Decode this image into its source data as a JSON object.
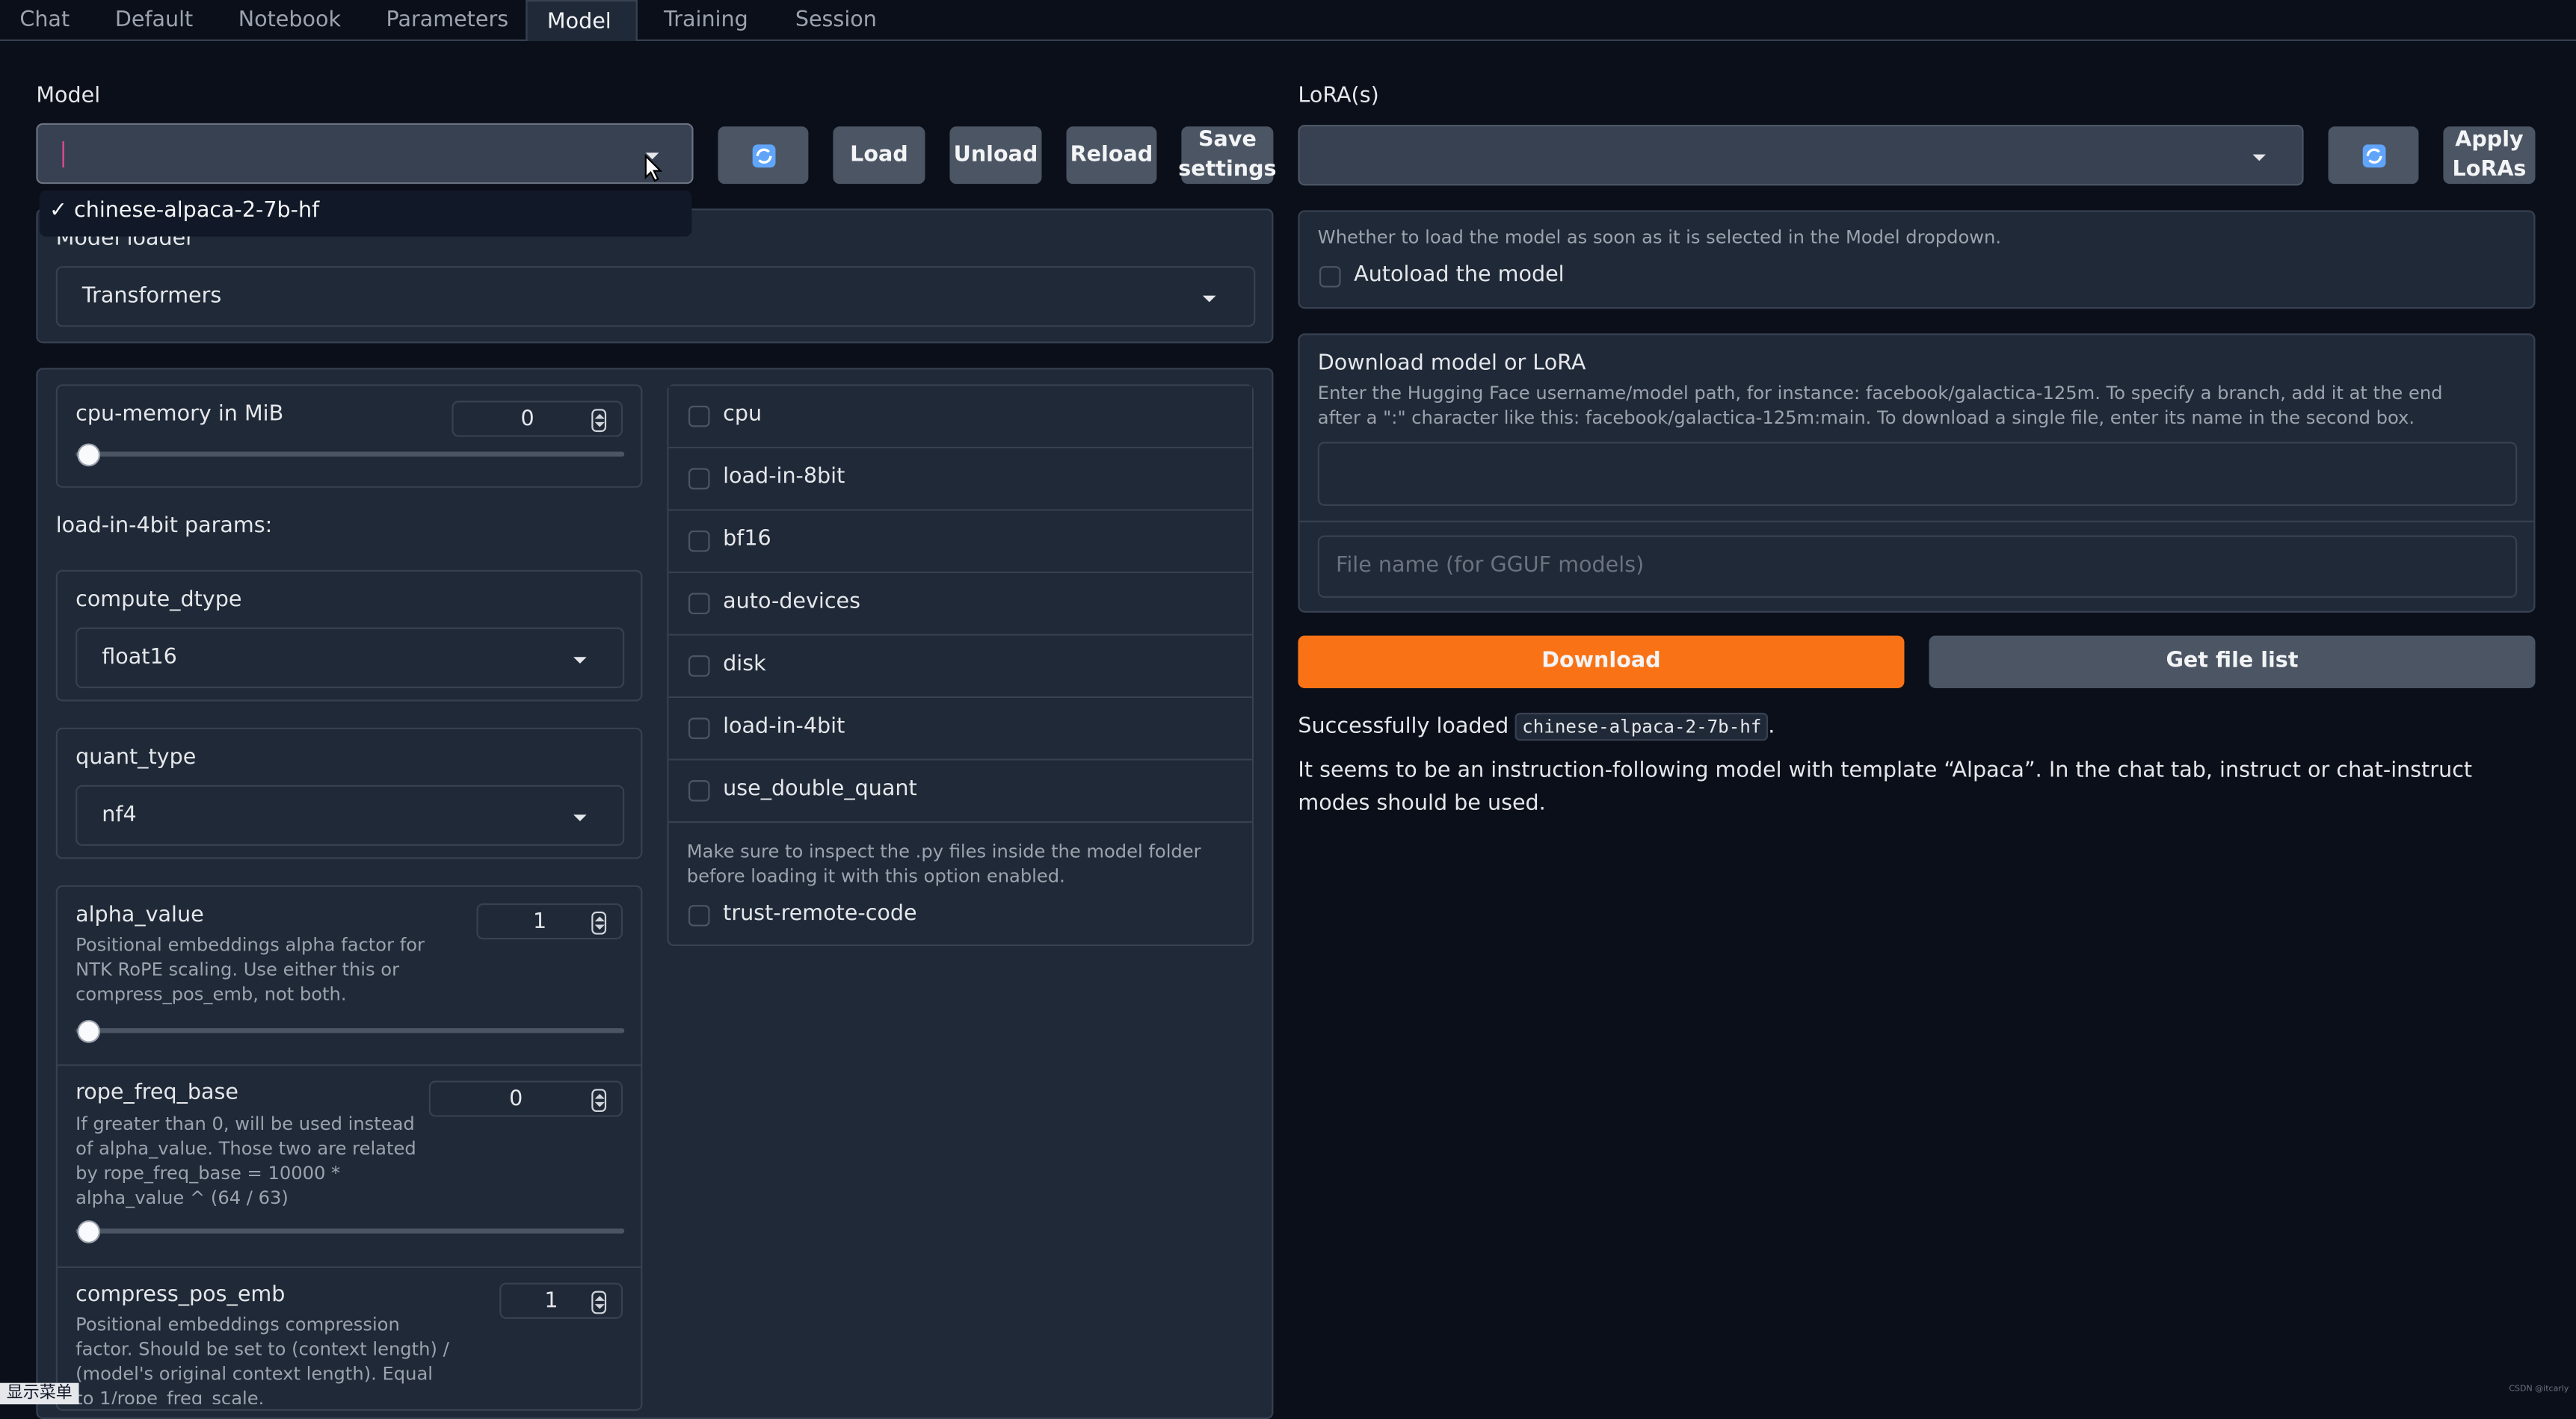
{
  "tabs": [
    "Chat",
    "Default",
    "Notebook",
    "Parameters",
    "Model",
    "Training",
    "Session"
  ],
  "model": {
    "label": "Model",
    "value": "",
    "dropdown_option": "chinese-alpaca-2-7b-hf",
    "dropdown_check": "✓",
    "refresh_icon": "refresh-icon",
    "buttons": {
      "load": "Load",
      "unload": "Unload",
      "reload": "Reload",
      "save": "Save settings"
    }
  },
  "loader": {
    "label": "Model loader",
    "value": "Transformers"
  },
  "left_params": {
    "cpu_memory": {
      "label": "cpu-memory in MiB",
      "value": "0",
      "level": 0
    },
    "four_bit_label": "load-in-4bit params:",
    "compute_dtype": {
      "label": "compute_dtype",
      "value": "float16"
    },
    "quant_type": {
      "label": "quant_type",
      "value": "nf4"
    },
    "alpha_value": {
      "label": "alpha_value",
      "value": "1",
      "desc": "Positional embeddings alpha factor for NTK RoPE scaling. Use either this or compress_pos_emb, not both.",
      "level": 0
    },
    "rope_freq_base": {
      "label": "rope_freq_base",
      "value": "0",
      "desc": "If greater than 0, will be used instead of alpha_value. Those two are related by rope_freq_base = 10000 * alpha_value ^ (64 / 63)",
      "level": 0
    },
    "compress_pos_emb": {
      "label": "compress_pos_emb",
      "value": "1",
      "desc": "Positional embeddings compression factor. Should be set to (context length) / (model's original context length). Equal to 1/rope_freq_scale."
    }
  },
  "checkboxes": [
    "cpu",
    "load-in-8bit",
    "bf16",
    "auto-devices",
    "disk",
    "load-in-4bit",
    "use_double_quant"
  ],
  "trust": {
    "note": "Make sure to inspect the .py files inside the model folder before loading it with this option enabled.",
    "label": "trust-remote-code"
  },
  "lora": {
    "label": "LoRA(s)",
    "apply": "Apply LoRAs"
  },
  "autoload": {
    "desc": "Whether to load the model as soon as it is selected in the Model dropdown.",
    "label": "Autoload the model"
  },
  "download": {
    "title": "Download model or LoRA",
    "desc": "Enter the Hugging Face username/model path, for instance: facebook/galactica-125m. To specify a branch, add it at the end after a \":\" character like this: facebook/galactica-125m:main. To download a single file, enter its name in the second box.",
    "path_value": "",
    "file_placeholder": "File name (for GGUF models)",
    "download_btn": "Download",
    "filelist_btn": "Get file list"
  },
  "status": {
    "prefix": "Successfully loaded",
    "model_code": "chinese-alpaca-2-7b-hf",
    "suffix": ".",
    "message": "It seems to be an instruction-following model with template “Alpaca”. In the chat tab, instruct or chat-instruct modes should be used."
  },
  "footer": {
    "menu": "显示菜单",
    "watermark": "CSDN @itcarly"
  },
  "colors": {
    "accent": "#f97316",
    "bg": "#0b0f19",
    "panel": "#1f2937"
  }
}
